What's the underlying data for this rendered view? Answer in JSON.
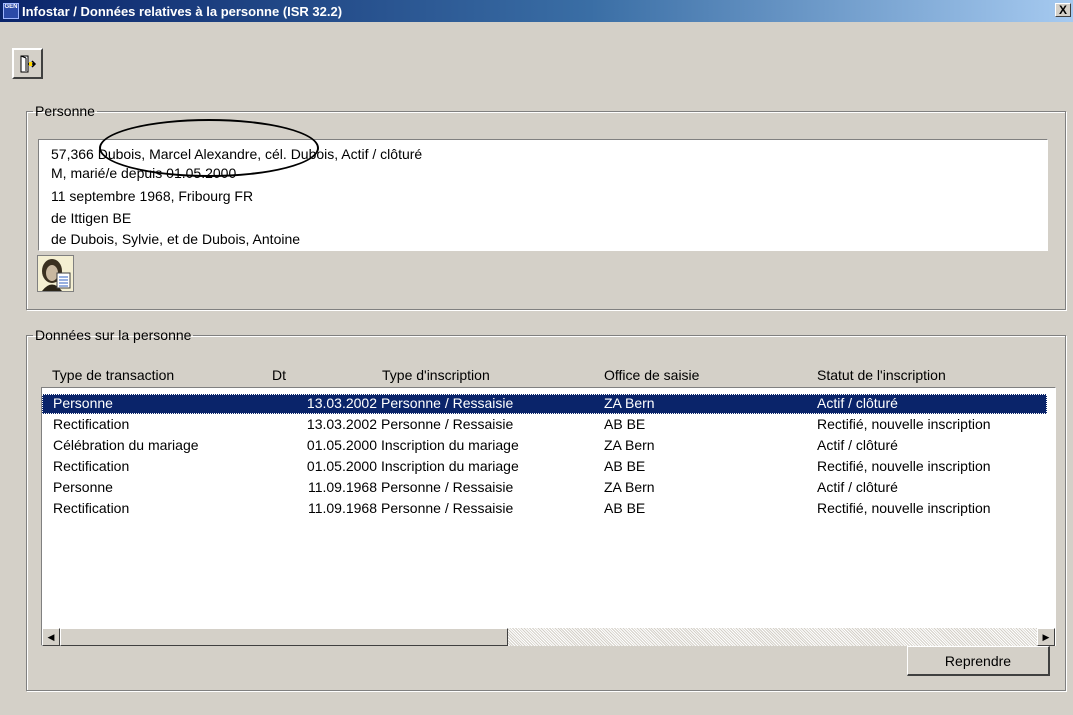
{
  "window": {
    "title": "Infostar / Données relatives à la personne (ISR 32.2)",
    "app_icon_text": "GEN",
    "close_symbol": "X"
  },
  "toolbar": {
    "exit_icon": "exit-door-icon"
  },
  "personne": {
    "legend": "Personne",
    "lines": [
      "57,366  Dubois, Marcel Alexandre, cél. Dubois, Actif / clôturé",
      "M, marié/e depuis 01.05.2000",
      "11 septembre 1968, Fribourg FR",
      "de Ittigen BE",
      "de Dubois, Sylvie, et de Dubois, Antoine"
    ],
    "person_icon": "person-details-icon"
  },
  "donnees": {
    "legend": "Données sur la personne",
    "columns": [
      "Type de transaction",
      "Dt",
      "Type d'inscription",
      "Office de saisie",
      "Statut de l'inscription"
    ],
    "rows": [
      [
        "Personne",
        "13.03.2002",
        "Personne / Ressaisie",
        "ZA Bern",
        "Actif / clôturé"
      ],
      [
        "Rectification",
        "13.03.2002",
        "Personne / Ressaisie",
        "AB BE",
        "Rectifié, nouvelle inscription"
      ],
      [
        "Célébration du mariage",
        "01.05.2000",
        "Inscription du mariage",
        "ZA Bern",
        "Actif / clôturé"
      ],
      [
        "Rectification",
        "01.05.2000",
        "Inscription du mariage",
        "AB BE",
        "Rectifié, nouvelle inscription"
      ],
      [
        "Personne",
        "11.09.1968",
        "Personne / Ressaisie",
        "ZA Bern",
        "Actif / clôturé"
      ],
      [
        "Rectification",
        "11.09.1968",
        "Personne / Ressaisie",
        "AB BE",
        "Rectifié, nouvelle inscription"
      ]
    ],
    "selected_row": 0,
    "scroll_left": "◀",
    "scroll_right": "▶"
  },
  "actions": {
    "reprendre_label": "Reprendre"
  },
  "colors": {
    "title_start": "#0a246a",
    "selection": "#0a246a",
    "window_bg": "#d4d0c8"
  }
}
